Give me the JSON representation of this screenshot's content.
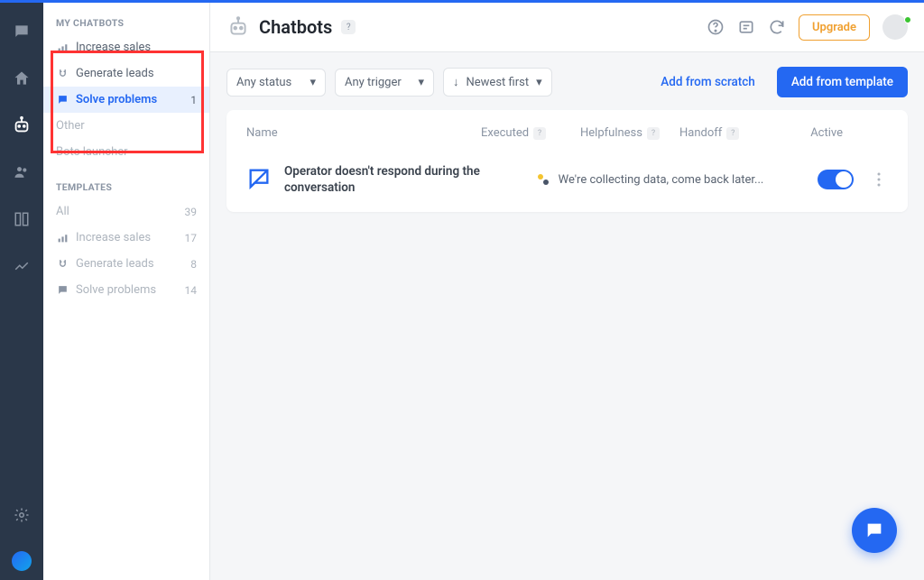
{
  "header": {
    "title": "Chatbots",
    "upgrade_label": "Upgrade"
  },
  "sidebar": {
    "my_chatbots_heading": "MY CHATBOTS",
    "my_items": [
      {
        "label": "Increase sales",
        "count": ""
      },
      {
        "label": "Generate leads",
        "count": ""
      },
      {
        "label": "Solve problems",
        "count": "1"
      },
      {
        "label": "Other",
        "count": ""
      },
      {
        "label": "Bots launcher",
        "count": ""
      }
    ],
    "templates_heading": "TEMPLATES",
    "template_items": [
      {
        "label": "All",
        "count": "39"
      },
      {
        "label": "Increase sales",
        "count": "17"
      },
      {
        "label": "Generate leads",
        "count": "8"
      },
      {
        "label": "Solve problems",
        "count": "14"
      }
    ]
  },
  "filters": {
    "status": "Any status",
    "trigger": "Any trigger",
    "sort": "Newest first"
  },
  "actions": {
    "add_scratch": "Add from scratch",
    "add_template": "Add from template"
  },
  "table": {
    "cols": {
      "name": "Name",
      "executed": "Executed",
      "helpfulness": "Helpfulness",
      "handoff": "Handoff",
      "active": "Active"
    },
    "row": {
      "name": "Operator doesn't respond during the conversation",
      "collecting": "We're collecting data, come back later...",
      "active": true
    }
  }
}
